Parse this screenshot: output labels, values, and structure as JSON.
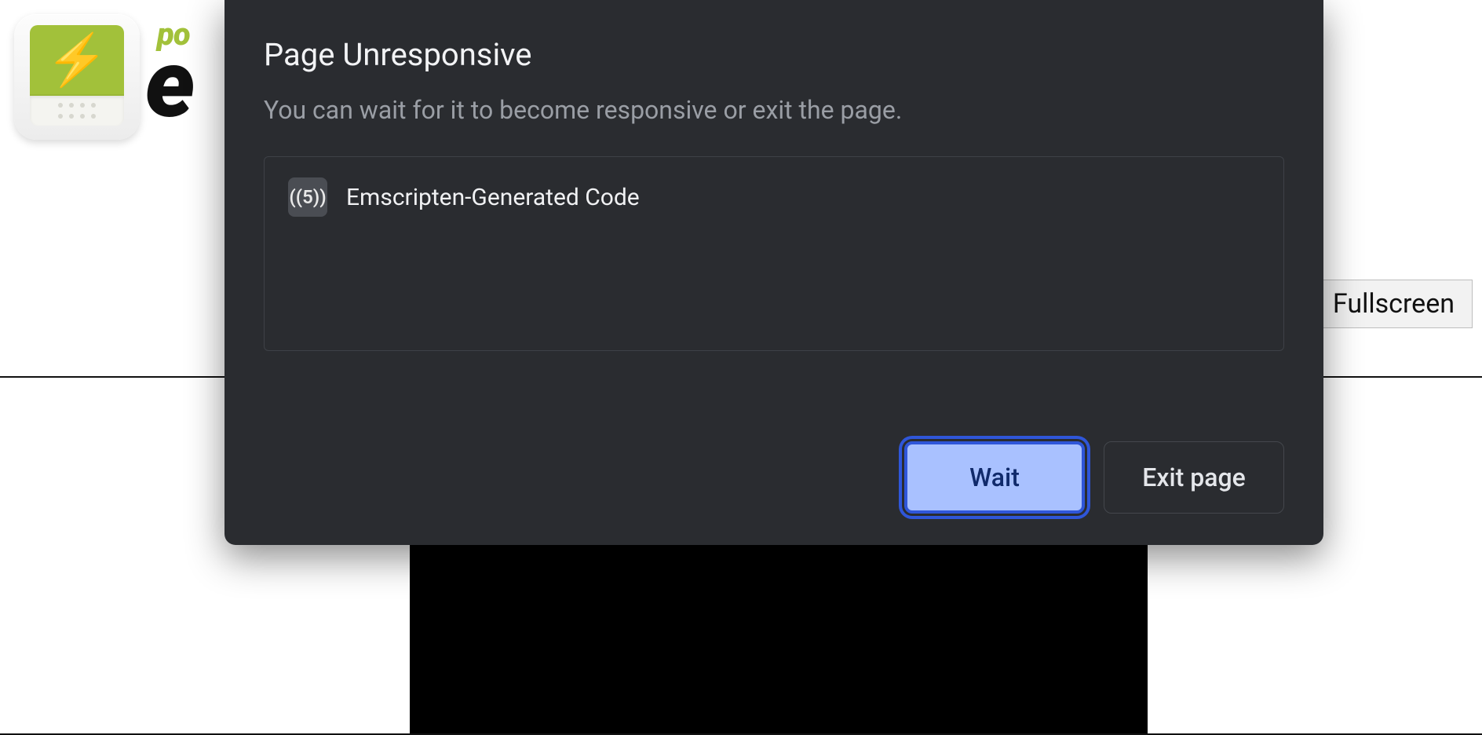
{
  "page": {
    "wordmark_small": "po",
    "wordmark_large": "e",
    "fullscreen_label": "Fullscreen"
  },
  "dialog": {
    "title": "Page Unresponsive",
    "subtitle": "You can wait for it to become responsive or exit the page.",
    "items": [
      {
        "icon_text": "((5))",
        "label": "Emscripten-Generated Code"
      }
    ],
    "primary_label": "Wait",
    "secondary_label": "Exit page"
  }
}
